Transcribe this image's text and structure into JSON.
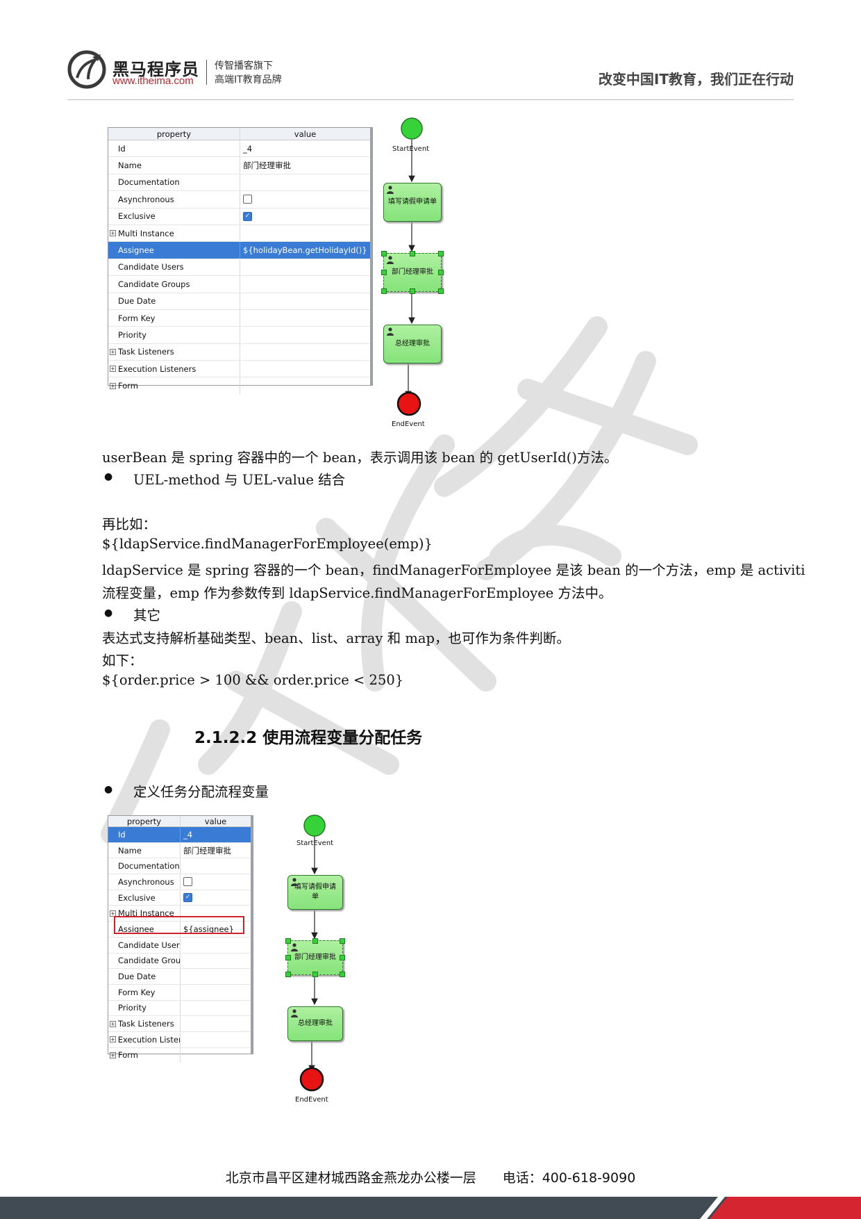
{
  "header": {
    "brand_name": "黑马程序员",
    "brand_url": "www.itheima.com",
    "brand_sub1": "传智播客旗下",
    "brand_sub2": "高端IT教育品牌",
    "slogan": "改变中国IT教育，我们正在行动"
  },
  "figure1": {
    "table": {
      "col_property": "property",
      "col_value": "value",
      "rows": [
        {
          "prop": "Id",
          "value": "_4"
        },
        {
          "prop": "Name",
          "value": "部门经理审批"
        },
        {
          "prop": "Documentation",
          "value": ""
        },
        {
          "prop": "Asynchronous",
          "value": ""
        },
        {
          "prop": "Exclusive",
          "value": ""
        },
        {
          "prop": "Multi Instance",
          "value": ""
        },
        {
          "prop": "Assignee",
          "value": "${holidayBean.getHolidayId()}"
        },
        {
          "prop": "Candidate Users",
          "value": ""
        },
        {
          "prop": "Candidate Groups",
          "value": ""
        },
        {
          "prop": "Due Date",
          "value": ""
        },
        {
          "prop": "Form Key",
          "value": ""
        },
        {
          "prop": "Priority",
          "value": ""
        },
        {
          "prop": "Task Listeners",
          "value": ""
        },
        {
          "prop": "Execution Listeners",
          "value": ""
        },
        {
          "prop": "Form",
          "value": ""
        }
      ]
    },
    "diagram": {
      "start_label": "StartEvent",
      "task1": "填写请假申请单",
      "task2": "部门经理审批",
      "task3": "总经理审批",
      "end_label": "EndEvent"
    }
  },
  "body": {
    "line1": "userBean 是 spring 容器中的一个 bean，表示调用该 bean 的 getUserId()方法。",
    "bullet1": "UEL-method 与 UEL-value 结合",
    "p_example": "再比如：",
    "code1": "${ldapService.findManagerForEmployee(emp)}",
    "p2_line1": "ldapService 是 spring 容器的一个 bean，findManagerForEmployee 是该 bean 的一个方法，emp 是 activiti",
    "p2_line2": "流程变量，emp 作为参数传到 ldapService.findManagerForEmployee 方法中。",
    "bullet2": "其它",
    "p3": "表达式支持解析基础类型、bean、list、array 和 map，也可作为条件判断。",
    "p4": "如下：",
    "code2": "${order.price > 100 && order.price < 250}",
    "section_heading": "2.1.2.2 使用流程变量分配任务",
    "bullet3": "定义任务分配流程变量",
    "bullet_glyph": "●"
  },
  "figure2": {
    "table": {
      "col_property": "property",
      "col_value": "value",
      "rows": [
        {
          "prop": "Id",
          "value": "_4"
        },
        {
          "prop": "Name",
          "value": "部门经理审批"
        },
        {
          "prop": "Documentation",
          "value": ""
        },
        {
          "prop": "Asynchronous",
          "value": ""
        },
        {
          "prop": "Exclusive",
          "value": ""
        },
        {
          "prop": "Multi Instance",
          "value": ""
        },
        {
          "prop": "Assignee",
          "value": "${assignee}"
        },
        {
          "prop": "Candidate Users",
          "value": ""
        },
        {
          "prop": "Candidate Grou|",
          "value": ""
        },
        {
          "prop": "Due Date",
          "value": ""
        },
        {
          "prop": "Form Key",
          "value": ""
        },
        {
          "prop": "Priority",
          "value": ""
        },
        {
          "prop": "Task Listeners",
          "value": ""
        },
        {
          "prop": "Execution Listen",
          "value": ""
        },
        {
          "prop": "Form",
          "value": ""
        }
      ]
    },
    "diagram": {
      "start_label": "StartEvent",
      "task1": "填写请假申请单",
      "task2": "部门经理审批",
      "task3": "总经理审批",
      "end_label": "EndEvent"
    }
  },
  "footer": {
    "address": "北京市昌平区建材城西路金燕龙办公楼一层　　电话：400-618-9090"
  },
  "colors": {
    "accent_red": "#c0272d",
    "selection_blue": "#3a7bd5",
    "task_green": "#86e37a",
    "footer_bar": "#414b54"
  }
}
